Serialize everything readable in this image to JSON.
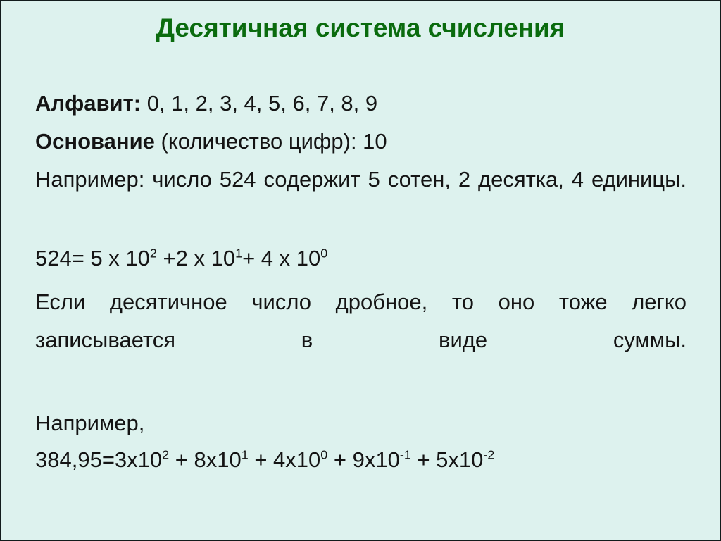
{
  "slide": {
    "title": "Десятичная система счисления",
    "title_color": "#0a6b0e",
    "background_color": "#ddf2ee",
    "border_color": "#121c1c",
    "text_color": "#141414"
  },
  "content": {
    "alphabet": {
      "label": "Алфавит:",
      "value": " 0, 1, 2, 3, 4, 5, 6, 7, 8, 9"
    },
    "base": {
      "label": "Основание",
      "value": " (количество цифр): 10"
    },
    "example_integer": {
      "text": "Например: число 524 содержит 5 сотен, 2 десятка, 4 единицы."
    },
    "formula_integer": {
      "part1": "524= 5 x 10",
      "sup1": "2",
      "part2": " +2 x 10",
      "sup2": "1",
      "part3": "+ 4 x 10",
      "sup3": "0"
    },
    "fraction_note": {
      "text": "Если десятичное число дробное, то оно тоже легко записывается в виде суммы."
    },
    "example_label": {
      "text": "Например,"
    },
    "formula_fraction": {
      "part1": "384,95=3x10",
      "sup1": "2",
      "part2": " + 8x10",
      "sup2": "1",
      "part3": " + 4x10",
      "sup3": "0",
      "part4": " + 9x10",
      "sup4": "-1",
      "part5": " + 5x10",
      "sup5": "-2"
    }
  }
}
